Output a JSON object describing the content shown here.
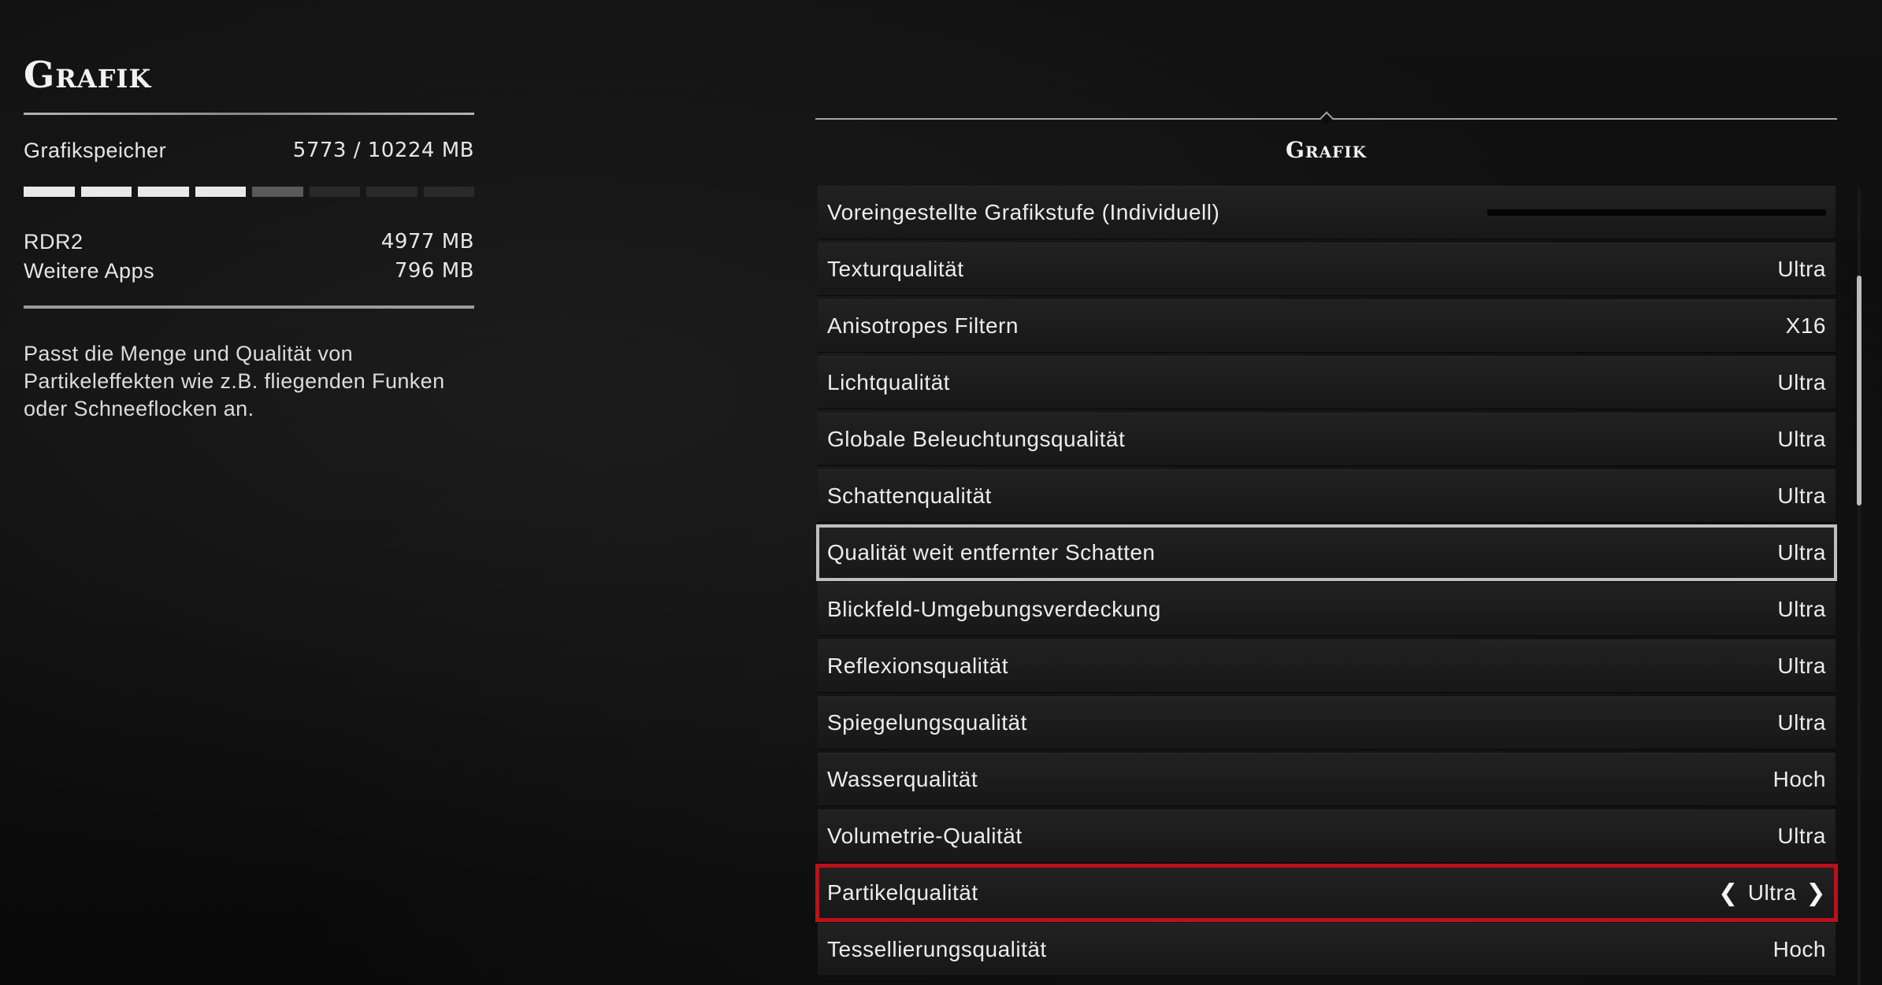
{
  "left": {
    "title": "Grafik",
    "memory": {
      "label": "Grafikspeicher",
      "value": "5773  / 10224  MB",
      "segments": [
        "full",
        "full",
        "full",
        "full",
        "part",
        "gray",
        "empty",
        "empty",
        "empty",
        "empty",
        "empty",
        "empty"
      ]
    },
    "rdr2": {
      "label": "RDR2",
      "value": "4977  MB"
    },
    "other_apps": {
      "label": "Weitere Apps",
      "value": "796  MB"
    },
    "description": "Passt die Menge und Qualität von Partikeleffekten wie z.B. fliegenden Funken oder Schneeflocken an."
  },
  "right": {
    "title": "Grafik",
    "settings": [
      {
        "label": "Voreingestellte Grafikstufe (Individuell)",
        "value": ""
      },
      {
        "label": "Texturqualität",
        "value": "Ultra"
      },
      {
        "label": "Anisotropes Filtern",
        "value": "X16"
      },
      {
        "label": "Lichtqualität",
        "value": "Ultra"
      },
      {
        "label": "Globale Beleuchtungsqualität",
        "value": "Ultra"
      },
      {
        "label": "Schattenqualität",
        "value": "Ultra"
      },
      {
        "label": "Qualität weit entfernter Schatten",
        "value": "Ultra"
      },
      {
        "label": "Blickfeld-Umgebungsverdeckung",
        "value": "Ultra"
      },
      {
        "label": "Reflexionsqualität",
        "value": "Ultra"
      },
      {
        "label": "Spiegelungsqualität",
        "value": "Ultra"
      },
      {
        "label": "Wasserqualität",
        "value": "Hoch"
      },
      {
        "label": "Volumetrie-Qualität",
        "value": "Ultra"
      },
      {
        "label": "Partikelqualität",
        "value": "Ultra"
      },
      {
        "label": "Tessellierungsqualität",
        "value": "Hoch"
      }
    ],
    "arrows": {
      "left": "❮",
      "right": "❯"
    }
  },
  "colors": {
    "background": "#0b0b0b",
    "row": "#1d1d1d",
    "selected_outline": "#b8121b",
    "hover_outline": "#bfbfbf",
    "text": "#ececec"
  }
}
